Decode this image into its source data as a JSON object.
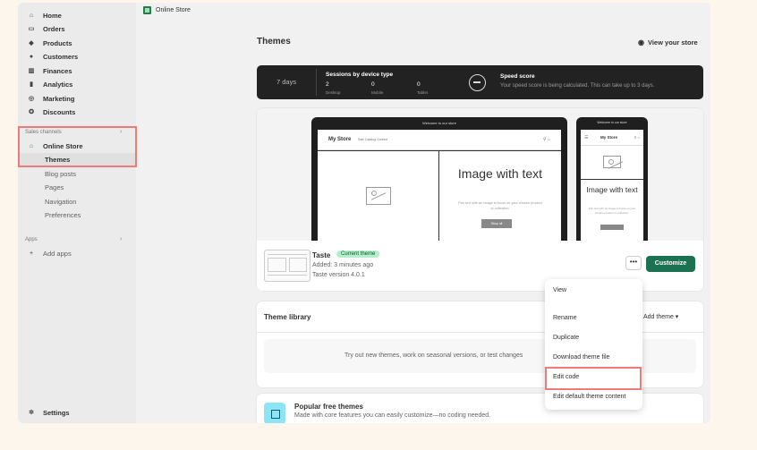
{
  "sidebar": {
    "items": [
      {
        "label": "Home",
        "icon": "house-icon",
        "glyph": "⌂"
      },
      {
        "label": "Orders",
        "icon": "inbox-icon",
        "glyph": "▭"
      },
      {
        "label": "Products",
        "icon": "tag-icon",
        "glyph": "◆"
      },
      {
        "label": "Customers",
        "icon": "person-icon",
        "glyph": "●"
      },
      {
        "label": "Finances",
        "icon": "bank-icon",
        "glyph": "▥"
      },
      {
        "label": "Analytics",
        "icon": "bar-chart-icon",
        "glyph": "▮"
      },
      {
        "label": "Marketing",
        "icon": "target-icon",
        "glyph": "◎"
      },
      {
        "label": "Discounts",
        "icon": "percent-icon",
        "glyph": "✪"
      }
    ],
    "sales_channels_label": "Sales channels",
    "online_store_label": "Online Store",
    "sub_items": [
      "Themes",
      "Blog posts",
      "Pages",
      "Navigation",
      "Preferences"
    ],
    "apps_label": "Apps",
    "add_apps_label": "Add apps",
    "settings_label": "Settings"
  },
  "topbar": {
    "breadcrumb": "Online Store"
  },
  "page": {
    "title": "Themes",
    "view_store": "View your store"
  },
  "speed": {
    "period": "7 days",
    "sessions_title": "Sessions by device type",
    "desktop_value": "2",
    "desktop_label": "Desktop",
    "mobile_value": "0",
    "mobile_label": "Mobile",
    "tablet_value": "0",
    "tablet_label": "Tablet",
    "score_title": "Speed score",
    "score_sub": "Your speed score is being calculated. This can take up to 3 days."
  },
  "preview": {
    "laptop_note": "Welcome to our store",
    "store_name": "My Store",
    "nav_links": "Sale   Catalog   Contact",
    "nav_icons": "⚲  ⌂",
    "heading": "Image with text",
    "body": "Pair text with an image to focus on your chosen product or collection.",
    "button": "Shop all",
    "phone_note": "Welcome to our store",
    "phone_menu": "☰",
    "phone_store": "My Store",
    "phone_icons": "⚲ ⌂",
    "phone_heading": "Image with text",
    "phone_body": "Pair text with an image to focus on your chosen product or collection."
  },
  "theme": {
    "name": "Taste",
    "badge": "Current theme",
    "added": "Added: 3 minutes ago",
    "version": "Taste version 4.0.1",
    "more": "•••",
    "customize": "Customize"
  },
  "library": {
    "title": "Theme library",
    "add_theme": "Add theme  ▾",
    "empty_text": "Try out new themes, work on seasonal versions, or test changes"
  },
  "popular": {
    "title": "Popular free themes",
    "sub": "Made with core features you can easily customize—no coding needed."
  },
  "dropdown": {
    "items": [
      "View",
      "Rename",
      "Duplicate",
      "Download theme file",
      "Edit code",
      "Edit default theme content"
    ]
  },
  "colors": {
    "accent": "#1a7250",
    "highlight": "#ef7a78",
    "badge_bg": "#b3f0ca"
  }
}
